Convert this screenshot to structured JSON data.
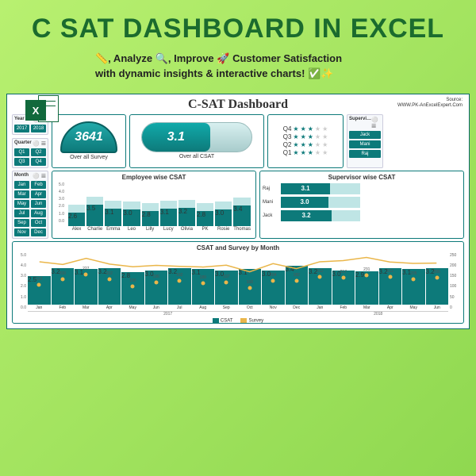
{
  "hero": {
    "title": "C SAT DASHBOARD IN EXCEL",
    "subtitle": "📏, Analyze 🔍, Improve 🚀 Customer Satisfaction with dynamic insights & interactive charts! ✅✨",
    "icon_letter": "X"
  },
  "dash": {
    "title": "C-SAT Dashboard",
    "source_lbl": "Source:",
    "source_val": "WWW.PK-AnExcelExpert.Com"
  },
  "slicers": {
    "year": {
      "label": "Year",
      "filter": "⚪ 𝌆",
      "items": [
        "2017",
        "2018"
      ]
    },
    "quarter": {
      "label": "Quarter",
      "filter": "⚪ 𝌆",
      "items": [
        "Q1",
        "Q2",
        "Q3",
        "Q4"
      ]
    },
    "month": {
      "label": "Month",
      "filter": "⚪ 𝌆",
      "items": [
        "Jan",
        "Feb",
        "Mar",
        "Apr",
        "May",
        "Jun",
        "Jul",
        "Aug",
        "Sep",
        "Oct",
        "Nov",
        "Dec"
      ]
    },
    "supervisor": {
      "label": "Supervi…",
      "filter": "⚪ 𝌆",
      "items": [
        "Jack",
        "Mani",
        "Raj"
      ]
    }
  },
  "kpi": {
    "survey_value": "3641",
    "survey_label": "Over all Survey",
    "csat_value": "3.1",
    "csat_label": "Over all CSAT"
  },
  "stars": {
    "rows": [
      {
        "q": "Q4",
        "n": 3
      },
      {
        "q": "Q3",
        "n": 3
      },
      {
        "q": "Q2",
        "n": 3
      },
      {
        "q": "Q1",
        "n": 3
      }
    ]
  },
  "chart_data": [
    {
      "type": "bar",
      "title": "Employee wise CSAT",
      "ylim": [
        0,
        5
      ],
      "categories": [
        "Alex",
        "Charlie",
        "Emma",
        "Leo",
        "Lilly",
        "Lucy",
        "Olivia",
        "PK",
        "Rosie",
        "Thomas"
      ],
      "values": [
        2.6,
        3.5,
        3.1,
        3.0,
        2.8,
        3.1,
        3.2,
        2.8,
        3.0,
        3.4
      ]
    },
    {
      "type": "bar",
      "title": "Supervisor wise CSAT",
      "orientation": "horizontal",
      "xlim": [
        0,
        5
      ],
      "categories": [
        "Raj",
        "Mani",
        "Jack"
      ],
      "values": [
        3.1,
        3.0,
        3.2
      ]
    },
    {
      "type": "bar+line",
      "title": "CSAT and Survey by Month",
      "ylim_left": [
        0,
        5
      ],
      "ylim_right": [
        0,
        250
      ],
      "x_groups": [
        "2017",
        "2018"
      ],
      "categories": [
        "Jan",
        "Feb",
        "Mar",
        "Apr",
        "May",
        "Jun",
        "Jul",
        "Aug",
        "Sep",
        "Oct",
        "Nov",
        "Dec",
        "Jan",
        "Feb",
        "Mar",
        "Apr",
        "May",
        "Jun"
      ],
      "series": [
        {
          "name": "CSAT",
          "axis": "left",
          "type": "bar",
          "values": [
            2.5,
            3.2,
            3.1,
            3.2,
            2.8,
            3.0,
            3.2,
            3.1,
            3.0,
            3.1,
            3.0,
            3.4,
            3.2,
            3.0,
            2.9,
            3.2,
            3.1,
            3.2
          ]
        },
        {
          "name": "Survey",
          "axis": "right",
          "type": "line",
          "values": [
            212,
            200,
            227,
            202,
            190,
            196,
            192,
            189,
            197,
            168,
            204,
            182,
            212,
            217,
            231,
            211,
            205,
            206
          ]
        }
      ],
      "legend": [
        "CSAT",
        "Survey"
      ]
    }
  ],
  "axis": {
    "emp": [
      "5.0",
      "4.0",
      "3.0",
      "2.0",
      "1.0",
      "0.0"
    ],
    "mleft": [
      "5.0",
      "4.0",
      "3.0",
      "2.0",
      "1.0",
      "0.0"
    ],
    "mright": [
      "250",
      "200",
      "150",
      "100",
      "50",
      "0"
    ]
  }
}
